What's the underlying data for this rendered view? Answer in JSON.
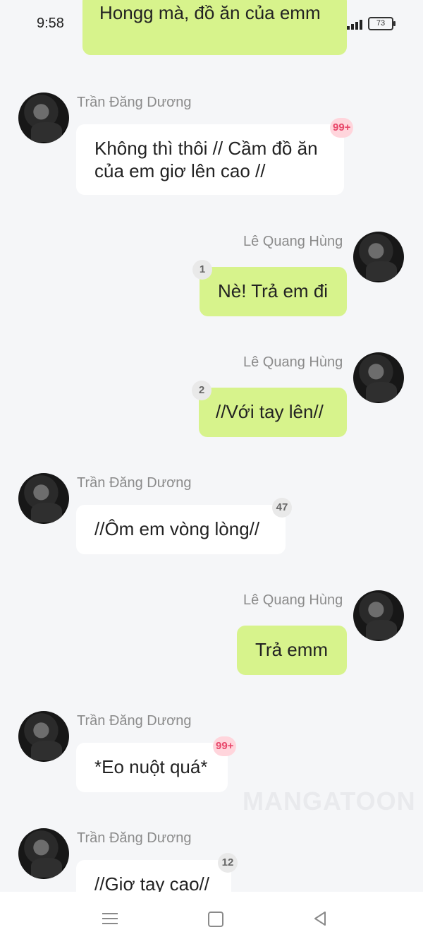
{
  "status_bar": {
    "time": "9:58",
    "battery": "73"
  },
  "messages": [
    {
      "sender": "",
      "side": "right",
      "text": "Hongg mà, đồ ăn của emm",
      "badge": ""
    },
    {
      "sender": "Trần Đăng Dương",
      "side": "left",
      "text": "Không thì thôi // Cầm đồ ăn của em giơ lên cao //",
      "badge": "99+"
    },
    {
      "sender": "Lê Quang Hùng",
      "side": "right",
      "text": "Nè! Trả em đi",
      "badge": "1"
    },
    {
      "sender": "Lê Quang Hùng",
      "side": "right",
      "text": "//Với tay lên//",
      "badge": "2"
    },
    {
      "sender": "Trần Đăng Dương",
      "side": "left",
      "text": "//Ôm em vòng lòng//",
      "badge": "47"
    },
    {
      "sender": "Lê Quang Hùng",
      "side": "right",
      "text": "Trả emm",
      "badge": ""
    },
    {
      "sender": "Trần Đăng Dương",
      "side": "left",
      "text": "*Eo nuột quá*",
      "badge": "99+"
    },
    {
      "sender": "Trần Đăng Dương",
      "side": "left",
      "text": "//Giơ tay cao//",
      "badge": "12"
    }
  ],
  "watermark": "MANGATOON",
  "colors": {
    "background": "#f5f6f8",
    "right_bubble": "#d7f38c",
    "left_bubble": "#ffffff",
    "badge_pink": "#e8476a"
  },
  "icons": {
    "nav": [
      "menu-icon",
      "home-icon",
      "back-icon"
    ]
  }
}
